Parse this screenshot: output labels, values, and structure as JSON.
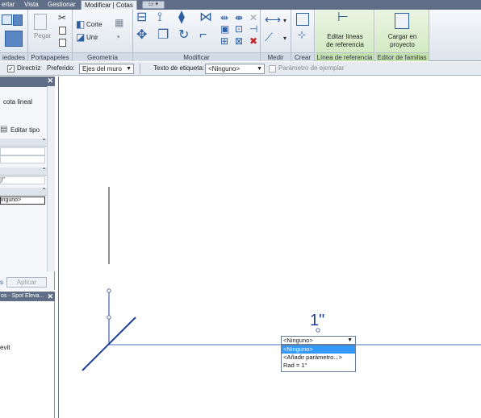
{
  "tabs": [
    {
      "label": "ertar",
      "active": false
    },
    {
      "label": "Vista",
      "active": false
    },
    {
      "label": "Gestionar",
      "active": false
    },
    {
      "label": "Modificar | Cotas",
      "active": true
    }
  ],
  "ribbon": {
    "panels": {
      "propiedades": "iedades",
      "portapapeles": "Portapapeles",
      "geometria": "Geometría",
      "modificar": "Modificar",
      "medir": "Medir",
      "crear": "Crear",
      "linea_referencia": "Línea de referencia",
      "editor_familias": "Editor de familias"
    },
    "buttons": {
      "pegar": "Pegar",
      "corte": "Corte",
      "unir": "Unir",
      "editar_lineas_1": "Editar líneas",
      "editar_lineas_2": "de referencia",
      "cargar_1": "Cargar en",
      "cargar_2": "proyecto"
    }
  },
  "options_bar": {
    "directriz_label": "Directriz",
    "directriz_checked": true,
    "preferido_label": "Preferido:",
    "preferido_value": "Ejes del muro",
    "etiqueta_label": "Texto de etiqueta:",
    "etiqueta_value": "<Ninguno>",
    "parametro_label": "Parámetro de ejemplar",
    "parametro_checked": false
  },
  "properties": {
    "type_text": "cota lineal",
    "edit_type": "Editar tipo",
    "row_value_1": ")\"",
    "row_value_2": "inguno>",
    "link_text": "s",
    "apply": "Aplicar"
  },
  "browser": {
    "title": "os - Spot Eleva...",
    "item": "evit"
  },
  "canvas": {
    "dimension_text": "1\"",
    "label_select": "<Ninguno>",
    "label_options": [
      "<Ninguno>",
      "<Añadir parámetro...>",
      "Rad = 1\""
    ],
    "selected_option": "<Ninguno>",
    "line_color": "#1f3f9a"
  }
}
